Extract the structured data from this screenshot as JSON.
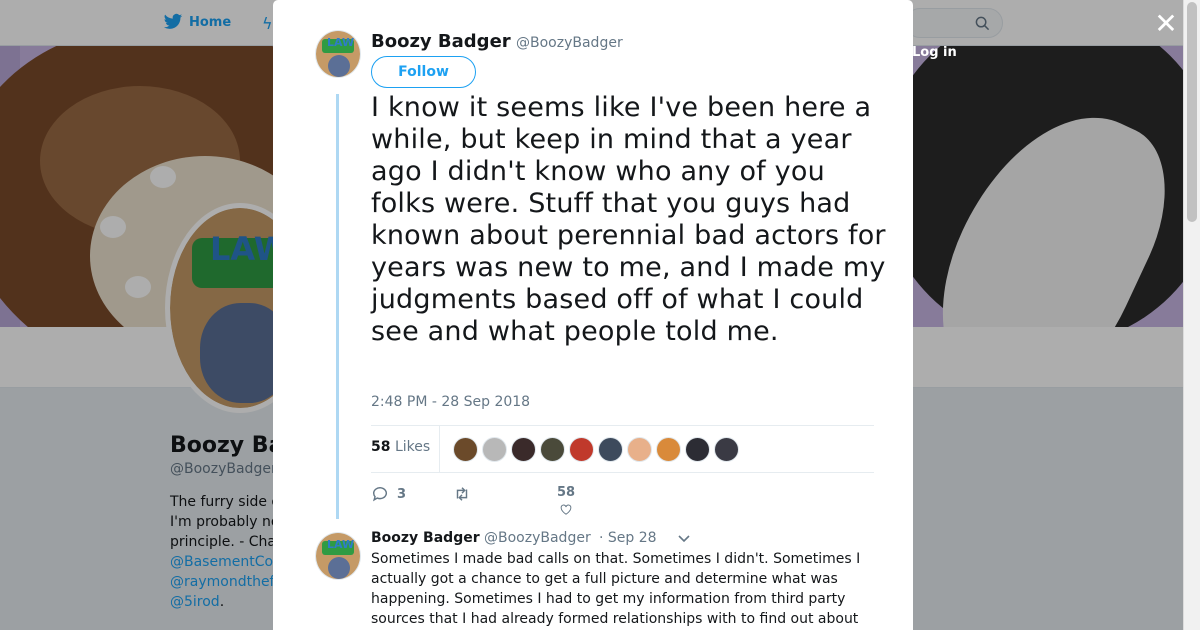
{
  "topnav": {
    "home_label": "Home",
    "login_label": "Log in"
  },
  "background_profile": {
    "name": "Boozy Ba",
    "handle": "@BoozyBadger",
    "bio_lines": [
      "The furry side o",
      "I'm probably no",
      "principle. - Cha"
    ],
    "bio_links": [
      "@BasementCo",
      "@raymondthef",
      "@5irod"
    ],
    "bio_tail": "."
  },
  "tweet": {
    "author_name": "Boozy Badger",
    "author_handle": "@BoozyBadger",
    "follow_label": "Follow",
    "text": "I know it seems like I've been here a while, but keep in mind that a year ago I didn't know who any of you folks were. Stuff that you guys had known about perennial bad actors for years was new to me, and I made my judgments based off of what I could see and what people told me.",
    "timestamp": "2:48 PM - 28 Sep 2018",
    "likes_count": "58",
    "likes_label": "Likes",
    "liker_colors": [
      "#6b4a2a",
      "#b8b8b8",
      "#3a2a2a",
      "#4a4a3a",
      "#c0392b",
      "#3d4a5c",
      "#e8b08a",
      "#d98a3a",
      "#2c2c34",
      "#3a3a44"
    ],
    "reply_count": "3",
    "retweet_count": "",
    "like_count": "58"
  },
  "reply": {
    "author_name": "Boozy Badger",
    "author_handle": "@BoozyBadger",
    "date": "· Sep 28",
    "text": "Sometimes I made bad calls on that.  Sometimes I didn't.  Sometimes I actually got a chance to get a full picture and determine what was happening.  Sometimes I had to get my information from third party sources that I had already formed relationships with to find out about"
  },
  "colors": {
    "accent": "#1da1f2",
    "thread_line": "#aed8f3"
  }
}
